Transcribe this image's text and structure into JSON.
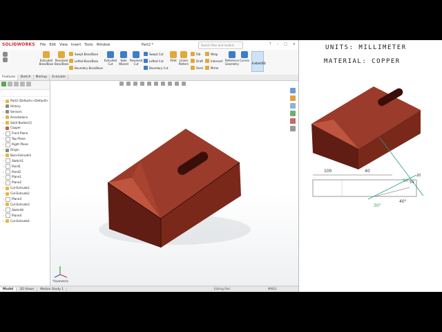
{
  "app": {
    "logo": "SOLIDWORKS",
    "menus": [
      "File",
      "Edit",
      "View",
      "Insert",
      "Tools",
      "Window"
    ],
    "doc_title": "Part2 *",
    "search_placeholder": "Search files and models"
  },
  "ribbon": {
    "extruded_boss": "Extruded Boss/Base",
    "revolved_boss": "Revolved Boss/Base",
    "swept_boss": "Swept Boss/Base",
    "lofted_boss": "Lofted Boss/Base",
    "boundary_boss": "Boundary Boss/Base",
    "extruded_cut": "Extruded Cut",
    "hole_wizard": "Hole Wizard",
    "revolved_cut": "Revolved Cut",
    "swept_cut": "Swept Cut",
    "lofted_cut": "Lofted Cut",
    "boundary_cut": "Boundary Cut",
    "fillet": "Fillet",
    "linear_pattern": "Linear Pattern",
    "rib": "Rib",
    "draft": "Draft",
    "shell": "Shell",
    "wrap": "Wrap",
    "intersect": "Intersect",
    "mirror": "Mirror",
    "reference_geometry": "Reference Geometry",
    "curves": "Curves",
    "instant3d": "Instant3D"
  },
  "tabs": [
    "Features",
    "Sketch",
    "Markup",
    "Evaluate"
  ],
  "tree": [
    {
      "label": "Part2 (Default<<Default>",
      "icon": "part-icon",
      "indent": 1
    },
    {
      "label": "History",
      "icon": "history-icon",
      "indent": 1
    },
    {
      "label": "Sensors",
      "icon": "sensor-icon",
      "indent": 1
    },
    {
      "label": "Annotations",
      "icon": "annotation-icon",
      "indent": 1
    },
    {
      "label": "Solid Bodies(1)",
      "icon": "solid-bodies-icon",
      "indent": 1
    },
    {
      "label": "Copper",
      "icon": "material-icon",
      "indent": 1
    },
    {
      "label": "Front Plane",
      "icon": "plane-icon",
      "indent": 1
    },
    {
      "label": "Top Plane",
      "icon": "plane-icon",
      "indent": 1
    },
    {
      "label": "Right Plane",
      "icon": "plane-icon",
      "indent": 1
    },
    {
      "label": "Origin",
      "icon": "origin-icon",
      "indent": 1
    },
    {
      "label": "Boss-Extrude1",
      "icon": "feature-icon",
      "indent": 1
    },
    {
      "label": "Sketch2",
      "icon": "sketch-icon",
      "indent": 1
    },
    {
      "label": "Point1",
      "icon": "point-icon",
      "indent": 1
    },
    {
      "label": "Point2",
      "icon": "point-icon",
      "indent": 1
    },
    {
      "label": "Plane1",
      "icon": "plane-icon",
      "indent": 1
    },
    {
      "label": "Plane2",
      "icon": "plane-icon",
      "indent": 1
    },
    {
      "label": "Cut-Extrude1",
      "icon": "feature-icon",
      "indent": 1
    },
    {
      "label": "Cut-Extrude2",
      "icon": "feature-icon",
      "indent": 1
    },
    {
      "label": "Plane3",
      "icon": "plane-icon",
      "indent": 1
    },
    {
      "label": "Cut-Extrude3",
      "icon": "feature-icon",
      "indent": 1
    },
    {
      "label": "Sketch8",
      "icon": "sketch-icon",
      "indent": 1
    },
    {
      "label": "Plane4",
      "icon": "plane-icon",
      "indent": 1
    },
    {
      "label": "Cut-Extrude4",
      "icon": "feature-icon",
      "indent": 1
    }
  ],
  "viewport": {
    "view_name": "*Isometric"
  },
  "bottom_tabs": [
    "Model",
    "3D Views",
    "Motion Study 1"
  ],
  "status": {
    "left": "Editing Part",
    "units": "MMGS"
  },
  "notes": {
    "units": "UNITS: MILLIMETER",
    "material": "MATERIAL: COPPER",
    "dims": [
      "100",
      "40",
      "40°",
      "30°",
      "10",
      "54",
      "20"
    ]
  },
  "colors": {
    "copper_top": "#9a3a2a",
    "copper_side": "#6b2218",
    "accent_blue": "#3d7cc9"
  }
}
